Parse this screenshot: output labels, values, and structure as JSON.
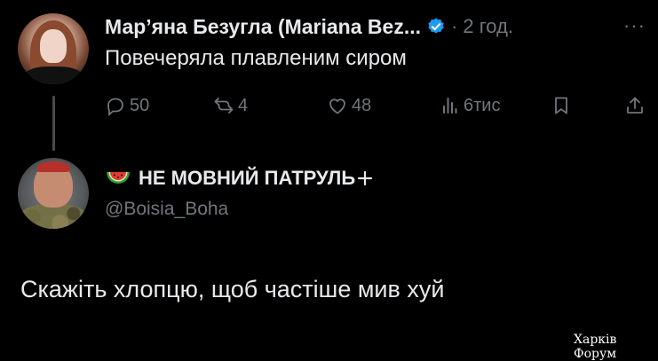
{
  "tweet": {
    "display_name": "Мар’яна Безугла (Mariana Bez...",
    "time": "· 2 год.",
    "more": "···",
    "text": "Повечеряла плавленим сиром",
    "actions": {
      "replies": "50",
      "reposts": "4",
      "likes": "48",
      "views": "6тис"
    }
  },
  "reply": {
    "display_name": "НЕ МОВНИЙ ПАТРУЛЬ",
    "handle": "@Boisia_Boha",
    "text": "Скажіть хлопцю, щоб частіше мив хуй"
  },
  "watermark": "Харків Форум",
  "colors": {
    "background": "#000000",
    "text": "#e7e9ea",
    "muted": "#71767b",
    "verified": "#1d9bf0"
  },
  "icons": {
    "verified": "verified-badge-icon",
    "reply": "reply-icon",
    "repost": "repost-icon",
    "like": "heart-icon",
    "views": "views-chart-icon",
    "bookmark": "bookmark-icon",
    "share": "share-icon",
    "watermelon": "watermelon-emoji-icon",
    "plus": "plus-icon"
  }
}
